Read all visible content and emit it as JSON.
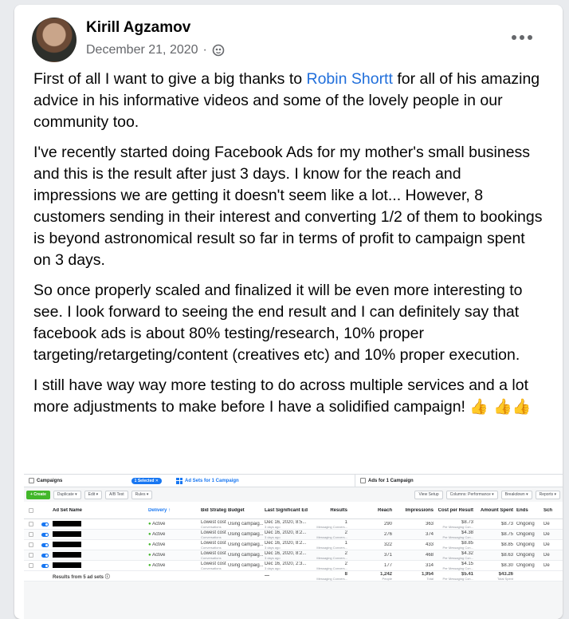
{
  "post": {
    "author": "Kirill Agzamov",
    "date": "December 21, 2020",
    "separator": "·",
    "paragraphs": [
      {
        "before": "First of all I want to give a big thanks to ",
        "link": "Robin Shortt",
        "after": " for all of his amazing advice in his informative videos and some of the lovely people in our community too."
      },
      {
        "text": "I've recently started doing Facebook Ads for my mother's small business and this is the result after just 3 days. I know for the reach and impressions we are getting it doesn't seem like a lot... However, 8 customers sending in their interest and converting 1/2 of them to bookings is beyond astronomical result so far in terms of profit to campaign spent on 3 days."
      },
      {
        "text": "So once properly scaled and finalized it will be even more interesting to see. I look forward to seeing the end result and I can definitely say that facebook ads is about 80% testing/research, 10% proper targeting/retargeting/content (creatives etc) and 10% proper execution."
      },
      {
        "text": "I still have way way more testing to do across multiple services and a lot more adjustments to make before I have a solidified campaign!",
        "emoji": "👍 👍👍"
      }
    ],
    "icons": {
      "privacy": "globe-icon",
      "menu": "more-options-icon"
    },
    "colors": {
      "link": "#216fdb",
      "meta": "#65676b"
    }
  },
  "ads_manager": {
    "tabs": {
      "campaigns": "Campaigns",
      "selected": "1 Selected ✕",
      "adsets": "Ad Sets for 1 Campaign",
      "ads": "Ads for 1 Campaign"
    },
    "toolbar": {
      "create": "+ Create",
      "duplicate": "Duplicate ▾",
      "edit": "Edit ▾",
      "abtest": "A/B Test",
      "rules": "Rules ▾",
      "view_setup": "View Setup",
      "columns": "Columns: Performance ▾",
      "breakdown": "Breakdown ▾",
      "reports": "Reports ▾"
    },
    "columns": [
      "Ad Set Name",
      "Delivery ↑",
      "Bid Strategy",
      "Budget",
      "Last Significant Edit",
      "Results",
      "Reach",
      "Impressions",
      "Cost per Result",
      "Amount Spent",
      "Ends",
      "Sch"
    ],
    "rows": [
      {
        "delivery": "Active",
        "bid": "Lowest cost",
        "bid_sub": "Conversations",
        "budget": "Using campaig...",
        "edit": "Dec 16, 2020, 8:5...",
        "edit_sub": "3 days ago",
        "results": "1",
        "results_sub": "Messaging Convers...",
        "reach": "290",
        "impressions": "363",
        "cpr": "$8.73",
        "cpr_sub": "Per Messaging Con...",
        "spent": "$8.73",
        "ends": "Ongoing",
        "sch": "De"
      },
      {
        "delivery": "Active",
        "bid": "Lowest cost",
        "bid_sub": "Conversations",
        "budget": "Using campaig...",
        "edit": "Dec 16, 2020, 8:2...",
        "edit_sub": "3 days ago",
        "results": "2",
        "results_sub": "Messaging Convers...",
        "reach": "276",
        "impressions": "374",
        "cpr": "$4.38",
        "cpr_sub": "Per Messaging Con...",
        "spent": "$8.75",
        "ends": "Ongoing",
        "sch": "De"
      },
      {
        "delivery": "Active",
        "bid": "Lowest cost",
        "bid_sub": "Conversations",
        "budget": "Using campaig...",
        "edit": "Dec 16, 2020, 8:2...",
        "edit_sub": "3 days ago",
        "results": "1",
        "results_sub": "Messaging Convers...",
        "reach": "322",
        "impressions": "433",
        "cpr": "$8.85",
        "cpr_sub": "Per Messaging Con...",
        "spent": "$8.85",
        "ends": "Ongoing",
        "sch": "De"
      },
      {
        "delivery": "Active",
        "bid": "Lowest cost",
        "bid_sub": "Conversations",
        "budget": "Using campaig...",
        "edit": "Dec 16, 2020, 8:2...",
        "edit_sub": "3 days ago",
        "results": "2",
        "results_sub": "Messaging Convers...",
        "reach": "371",
        "impressions": "468",
        "cpr": "$4.32",
        "cpr_sub": "Per Messaging Con...",
        "spent": "$8.63",
        "ends": "Ongoing",
        "sch": "De"
      },
      {
        "delivery": "Active",
        "bid": "Lowest cost",
        "bid_sub": "Conversations",
        "budget": "Using campaig...",
        "edit": "Dec 16, 2020, 2:3...",
        "edit_sub": "3 days ago",
        "results": "2",
        "results_sub": "Messaging Convers...",
        "reach": "177",
        "impressions": "314",
        "cpr": "$4.15",
        "cpr_sub": "Per Messaging Con...",
        "spent": "$8.30",
        "ends": "Ongoing",
        "sch": "De"
      }
    ],
    "totals": {
      "label": "Results from 5 ad sets ⓘ",
      "edit": "—",
      "results": "8",
      "results_sub": "Messaging Convers...",
      "reach": "1,242",
      "reach_sub": "People",
      "impressions": "1,954",
      "impressions_sub": "Total",
      "cpr": "$5.41",
      "cpr_sub": "Per Messaging Con...",
      "spent": "$43.26",
      "spent_sub": "Total Spent"
    }
  }
}
